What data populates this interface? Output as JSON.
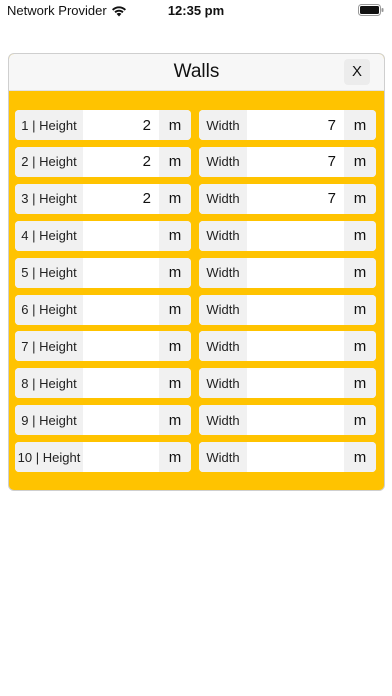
{
  "status_bar": {
    "carrier": "Network Provider",
    "time": "12:35 pm"
  },
  "modal": {
    "title": "Walls",
    "close_label": "X"
  },
  "walls": [
    {
      "height_label": "1 | Height",
      "height_value": "2",
      "height_unit": "m",
      "width_label": "Width",
      "width_value": "7",
      "width_unit": "m"
    },
    {
      "height_label": "2 | Height",
      "height_value": "2",
      "height_unit": "m",
      "width_label": "Width",
      "width_value": "7",
      "width_unit": "m"
    },
    {
      "height_label": "3 | Height",
      "height_value": "2",
      "height_unit": "m",
      "width_label": "Width",
      "width_value": "7",
      "width_unit": "m"
    },
    {
      "height_label": "4 | Height",
      "height_value": "",
      "height_unit": "m",
      "width_label": "Width",
      "width_value": "",
      "width_unit": "m"
    },
    {
      "height_label": "5 | Height",
      "height_value": "",
      "height_unit": "m",
      "width_label": "Width",
      "width_value": "",
      "width_unit": "m"
    },
    {
      "height_label": "6 | Height",
      "height_value": "",
      "height_unit": "m",
      "width_label": "Width",
      "width_value": "",
      "width_unit": "m"
    },
    {
      "height_label": "7 | Height",
      "height_value": "",
      "height_unit": "m",
      "width_label": "Width",
      "width_value": "",
      "width_unit": "m"
    },
    {
      "height_label": "8 | Height",
      "height_value": "",
      "height_unit": "m",
      "width_label": "Width",
      "width_value": "",
      "width_unit": "m"
    },
    {
      "height_label": "9 | Height",
      "height_value": "",
      "height_unit": "m",
      "width_label": "Width",
      "width_value": "",
      "width_unit": "m"
    },
    {
      "height_label": "10 | Height",
      "height_value": "",
      "height_unit": "m",
      "width_label": "Width",
      "width_value": "",
      "width_unit": "m"
    }
  ],
  "colors": {
    "panel_background": "#ffc300",
    "header_background": "#f7f7f7",
    "label_background": "#f1f1f1"
  },
  "icons": {
    "signal": "wifi-icon",
    "battery": "battery-icon"
  }
}
